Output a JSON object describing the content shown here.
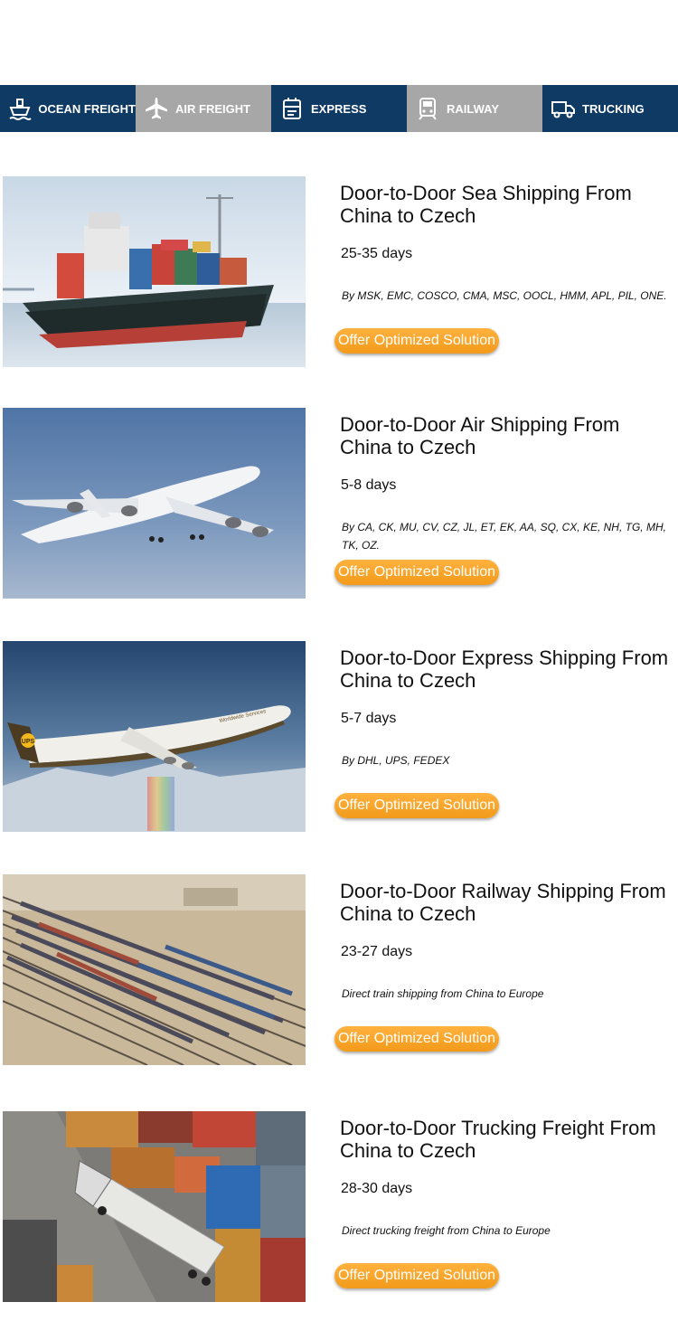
{
  "tabs": [
    {
      "label": "OCEAN FREIGHT",
      "icon": "ship-icon"
    },
    {
      "label": "AIR FREIGHT",
      "icon": "airplane-icon"
    },
    {
      "label": "EXPRESS",
      "icon": "express-box-icon"
    },
    {
      "label": "RAILWAY",
      "icon": "train-icon"
    },
    {
      "label": "TRUCKING",
      "icon": "truck-icon"
    }
  ],
  "services": [
    {
      "title": "Door-to-Door Sea Shipping From China to Czech",
      "days": "25-35 days",
      "carriers": "By MSK, EMC, COSCO, CMA, MSC, OOCL, HMM, APL, PIL, ONE.",
      "button": "Offer Optimized Solution",
      "image": "container-ship-photo"
    },
    {
      "title": "Door-to-Door Air Shipping From China to Czech",
      "days": "5-8 days",
      "carriers": "By CA, CK, MU, CV, CZ, JL, ET, EK, AA, SQ, CX, KE, NH, TG, MH, TK, OZ.",
      "button": "Offer Optimized Solution",
      "image": "cargo-airplane-photo"
    },
    {
      "title": "Door-to-Door Express Shipping From China to Czech",
      "days": "5-7 days",
      "carriers": "By DHL, UPS, FEDEX",
      "button": "Offer Optimized Solution",
      "image": "express-airplane-photo",
      "plane_logo": "UPS",
      "plane_text": "Worldwide Services"
    },
    {
      "title": "Door-to-Door Railway Shipping From China to Czech",
      "days": "23-27 days",
      "carriers": "Direct train shipping from China to Europe",
      "button": "Offer Optimized Solution",
      "image": "rail-yard-photo"
    },
    {
      "title": "Door-to-Door Trucking Freight From China to Czech",
      "days": "28-30 days",
      "carriers": "Direct trucking freight from China to Europe",
      "button": "Offer Optimized Solution",
      "image": "container-truck-photo"
    }
  ],
  "colors": {
    "tab_dark": "#0f3a63",
    "tab_gray": "#a7a7a7",
    "button": "#f6a12b"
  }
}
